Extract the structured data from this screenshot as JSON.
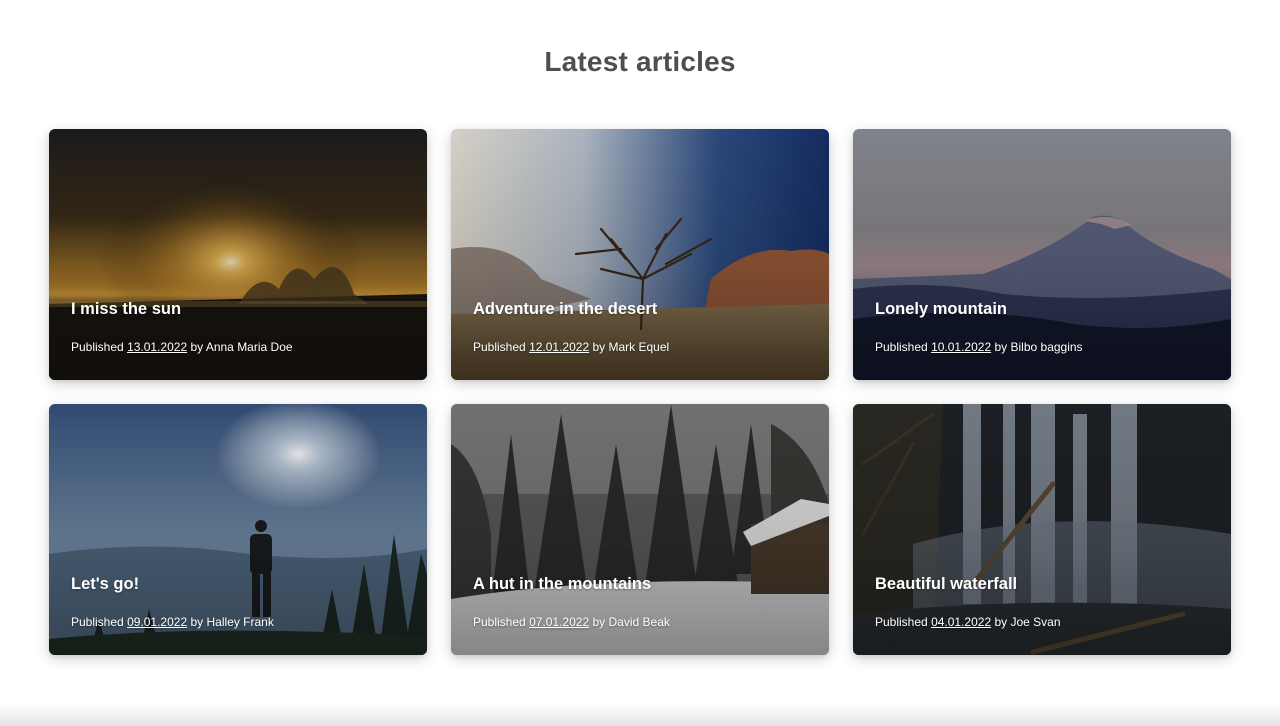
{
  "section": {
    "title": "Latest articles"
  },
  "labels": {
    "published": "Published",
    "by": "by"
  },
  "articles": [
    {
      "title": "I miss the sun",
      "date": "13.01.2022",
      "author": "Anna Maria Doe",
      "image": "sunset-sea-image"
    },
    {
      "title": "Adventure in the desert",
      "date": "12.01.2022",
      "author": "Mark Equel",
      "image": "desert-tree-image"
    },
    {
      "title": "Lonely mountain",
      "date": "10.01.2022",
      "author": "Bilbo baggins",
      "image": "mountain-image"
    },
    {
      "title": "Let's go!",
      "date": "09.01.2022",
      "author": "Halley Frank",
      "image": "hiker-image"
    },
    {
      "title": "A hut in the mountains",
      "date": "07.01.2022",
      "author": "David Beak",
      "image": "snowy-hut-image"
    },
    {
      "title": "Beautiful waterfall",
      "date": "04.01.2022",
      "author": "Joe Svan",
      "image": "waterfall-image"
    }
  ]
}
